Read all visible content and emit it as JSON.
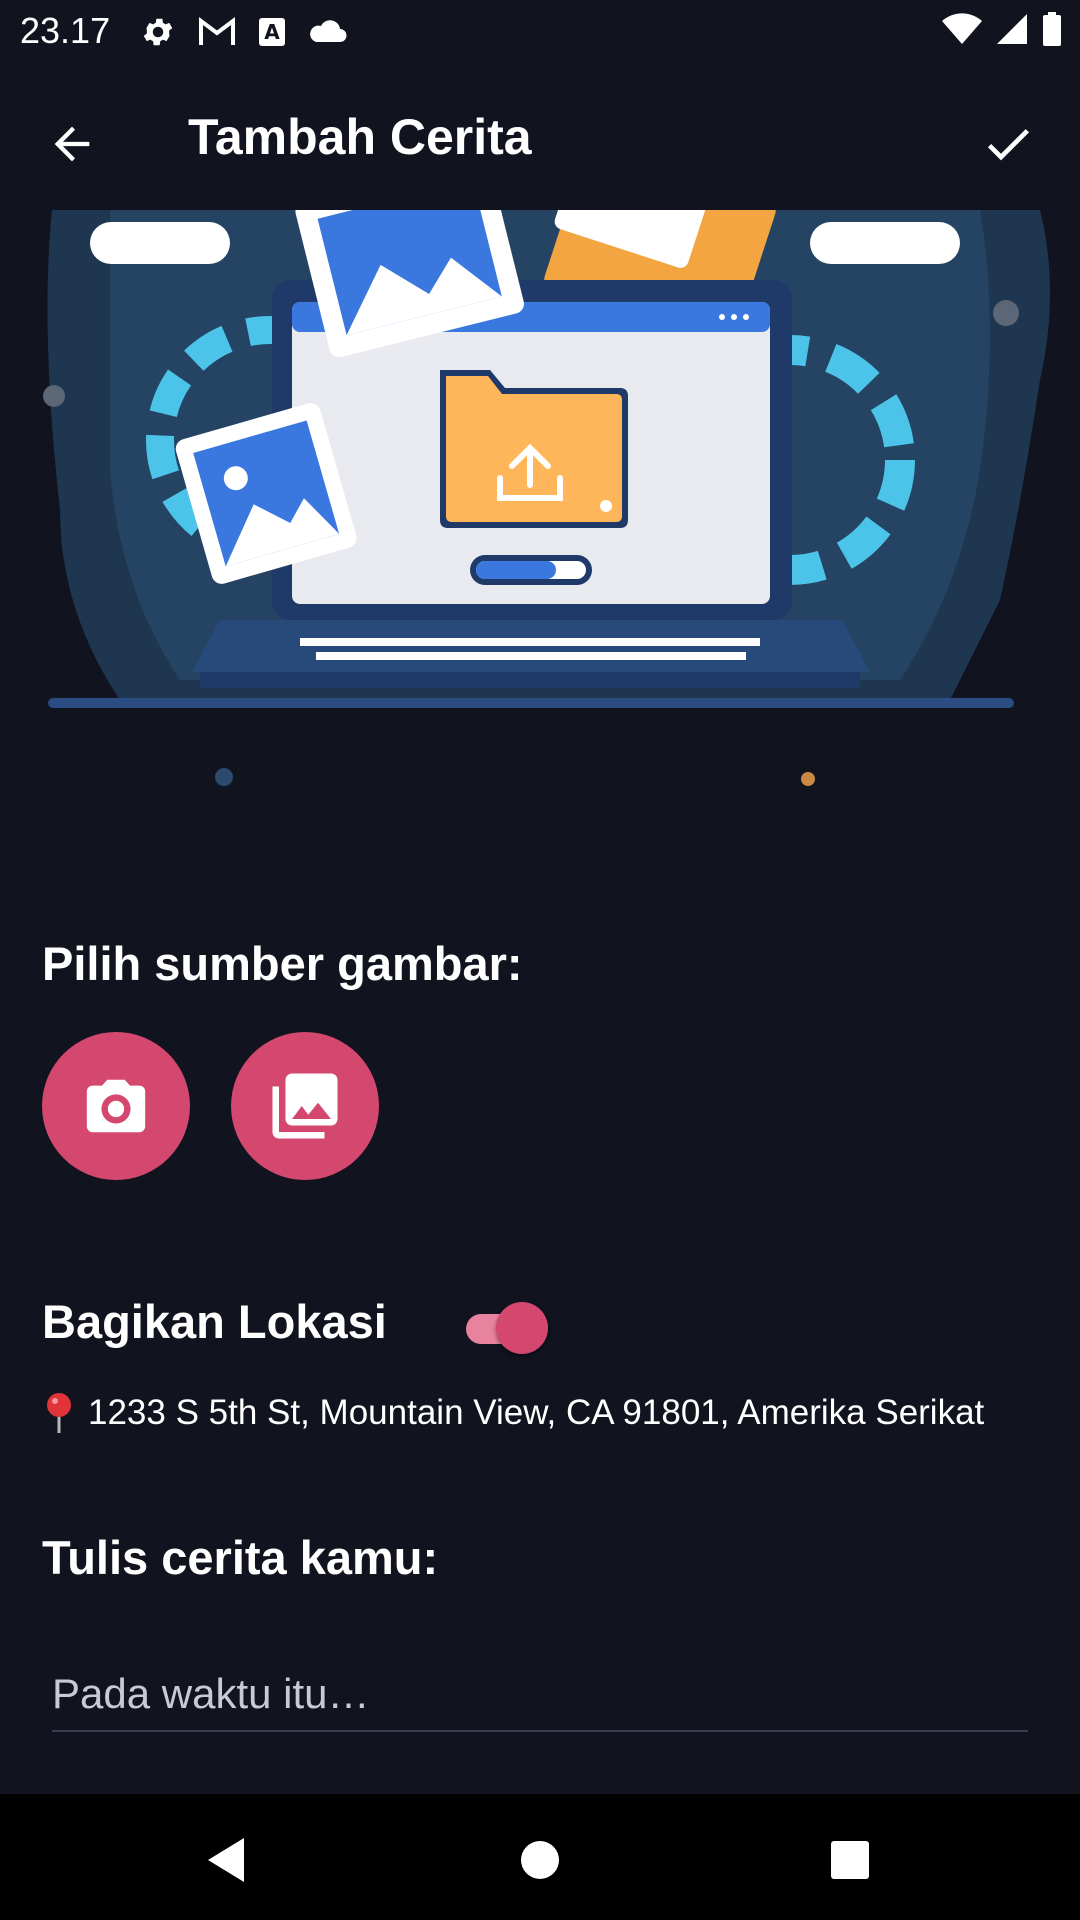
{
  "status_bar": {
    "time": "23.17",
    "left_icons": [
      "gear-icon",
      "gmail-icon",
      "font-a-icon",
      "cloud-icon"
    ],
    "right_icons": [
      "wifi-icon",
      "signal-icon",
      "battery-icon"
    ]
  },
  "toolbar": {
    "title": "Tambah Cerita",
    "back_icon": "arrow-left-icon",
    "confirm_icon": "check-icon"
  },
  "image_source": {
    "label": "Pilih sumber gambar:",
    "buttons": [
      {
        "icon": "camera-icon"
      },
      {
        "icon": "gallery-icon"
      }
    ]
  },
  "location": {
    "label": "Bagikan Lokasi",
    "enabled": true,
    "pin_icon": "map-pin-icon",
    "address": "1233 S 5th St, Mountain View, CA 91801, Amerika Serikat"
  },
  "story": {
    "label": "Tulis cerita kamu:",
    "placeholder": "Pada waktu itu…",
    "value": ""
  },
  "colors": {
    "background": "#11131f",
    "accent": "#d4486f",
    "accent_light": "#e8839f"
  },
  "nav_bar": {
    "icons": [
      "back-triangle-icon",
      "home-circle-icon",
      "recents-square-icon"
    ]
  }
}
